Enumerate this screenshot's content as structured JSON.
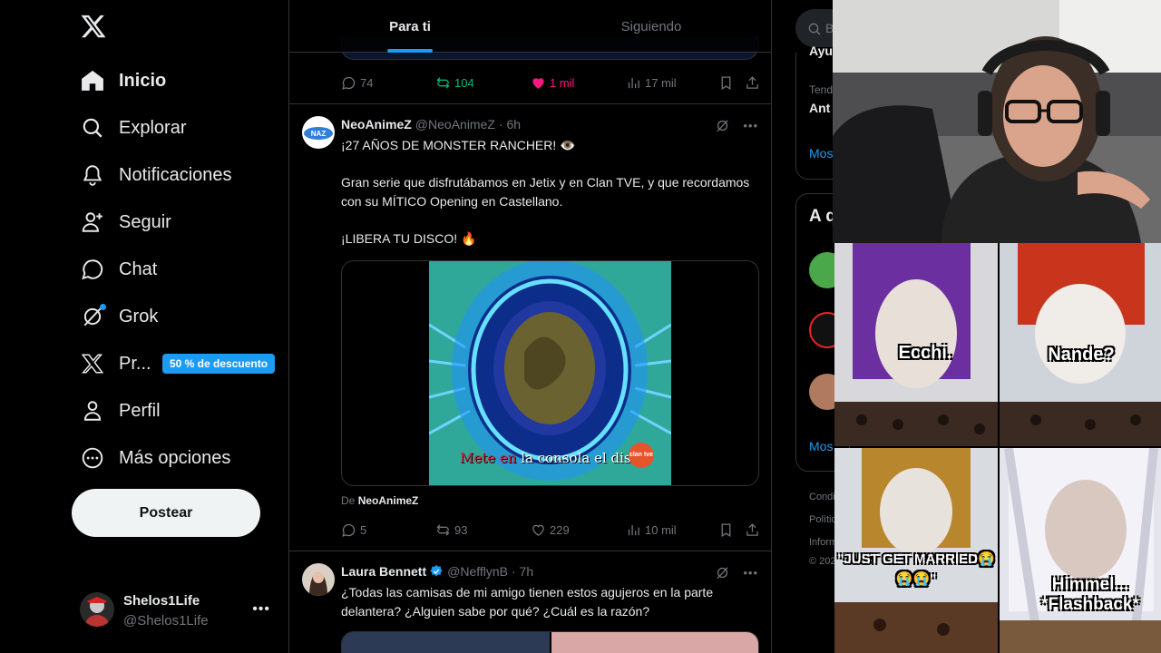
{
  "nav": {
    "items": [
      {
        "label": "Inicio",
        "icon": "home-icon"
      },
      {
        "label": "Explorar",
        "icon": "search-icon"
      },
      {
        "label": "Notificaciones",
        "icon": "bell-icon"
      },
      {
        "label": "Seguir",
        "icon": "follow-icon"
      },
      {
        "label": "Chat",
        "icon": "chat-icon"
      },
      {
        "label": "Grok",
        "icon": "grok-icon"
      },
      {
        "label": "Pr...",
        "icon": "x-logo-icon"
      },
      {
        "label": "Perfil",
        "icon": "profile-icon"
      },
      {
        "label": "Más opciones",
        "icon": "more-options-icon"
      }
    ],
    "premium_badge": "50 % de descuento",
    "post_button": "Postear",
    "account": {
      "name": "Shelos1Life",
      "handle": "@Shelos1Life"
    }
  },
  "timeline": {
    "tabs": [
      "Para ti",
      "Siguiendo"
    ],
    "prev_tweet_actions": {
      "replies": "74",
      "reposts": "104",
      "likes": "1 mil",
      "views": "17 mil"
    },
    "tweets": [
      {
        "name": "NeoAnimeZ",
        "handle": "@NeoAnimeZ",
        "time": "· 6h",
        "line1": "¡27 AÑOS DE MONSTER RANCHER! 👁️",
        "line2": "Gran serie que disfrutábamos en Jetix y en Clan TVE, y que recordamos con su MÍTICO Opening en Castellano.",
        "line3": "¡LIBERA TU DISCO! 🔥",
        "media_caption_red": "Mete en",
        "media_caption_white": "la consola el dis",
        "media_logo": "clan tve",
        "from_prefix": "De",
        "from_name": "NeoAnimeZ",
        "actions": {
          "replies": "5",
          "reposts": "93",
          "likes": "229",
          "views": "10 mil"
        }
      },
      {
        "name": "Laura Bennett",
        "handle": "@NefflynB",
        "time": "· 7h",
        "text": "¿Todas las camisas de mi amigo tienen estos agujeros en la parte delantera? ¿Alguien sabe por qué? ¿Cuál es la razón?"
      }
    ]
  },
  "right": {
    "search_placeholder": "B",
    "partial_texts": [
      "Ayu",
      "Tend",
      "Ant",
      "Mos",
      "A q",
      "Mos",
      "Condi",
      "Polític",
      "Inform",
      "© 202"
    ]
  },
  "stickers": [
    {
      "caption": "Ecchi."
    },
    {
      "caption": "Nande?"
    },
    {
      "caption": "\"JUST GET MARRIED😭😭😭\""
    },
    {
      "caption_line1": "Himmel...",
      "caption_line2": "*Flashback*"
    }
  ],
  "colors": {
    "accent": "#1d9bf0",
    "repost": "#00ba7c",
    "like": "#f91880",
    "border": "#2f3336",
    "muted": "#71767b"
  }
}
